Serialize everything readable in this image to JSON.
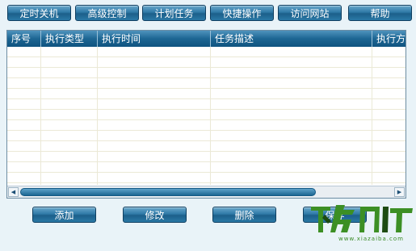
{
  "toolbar": {
    "buttons": [
      "定时关机",
      "高级控制",
      "计划任务",
      "快捷操作",
      "访问网站",
      "帮助"
    ]
  },
  "table": {
    "columns": [
      "序号",
      "执行类型",
      "执行时间",
      "任务描述",
      "执行方"
    ],
    "rows": []
  },
  "actions": {
    "add": "添加",
    "edit": "修改",
    "delete": "删除",
    "save": "保存"
  },
  "watermark": {
    "logo_text": "下载吧",
    "url": "www.xiazaiba.com",
    "colors": {
      "green": "#3c8f24",
      "dark": "#1d4b12"
    }
  },
  "colors": {
    "background": "#e9f3f8",
    "button_top": "#6aa8cb",
    "button_bottom": "#1c5f8a",
    "header": "#1d6693",
    "grid_line": "#ebe9d6"
  }
}
